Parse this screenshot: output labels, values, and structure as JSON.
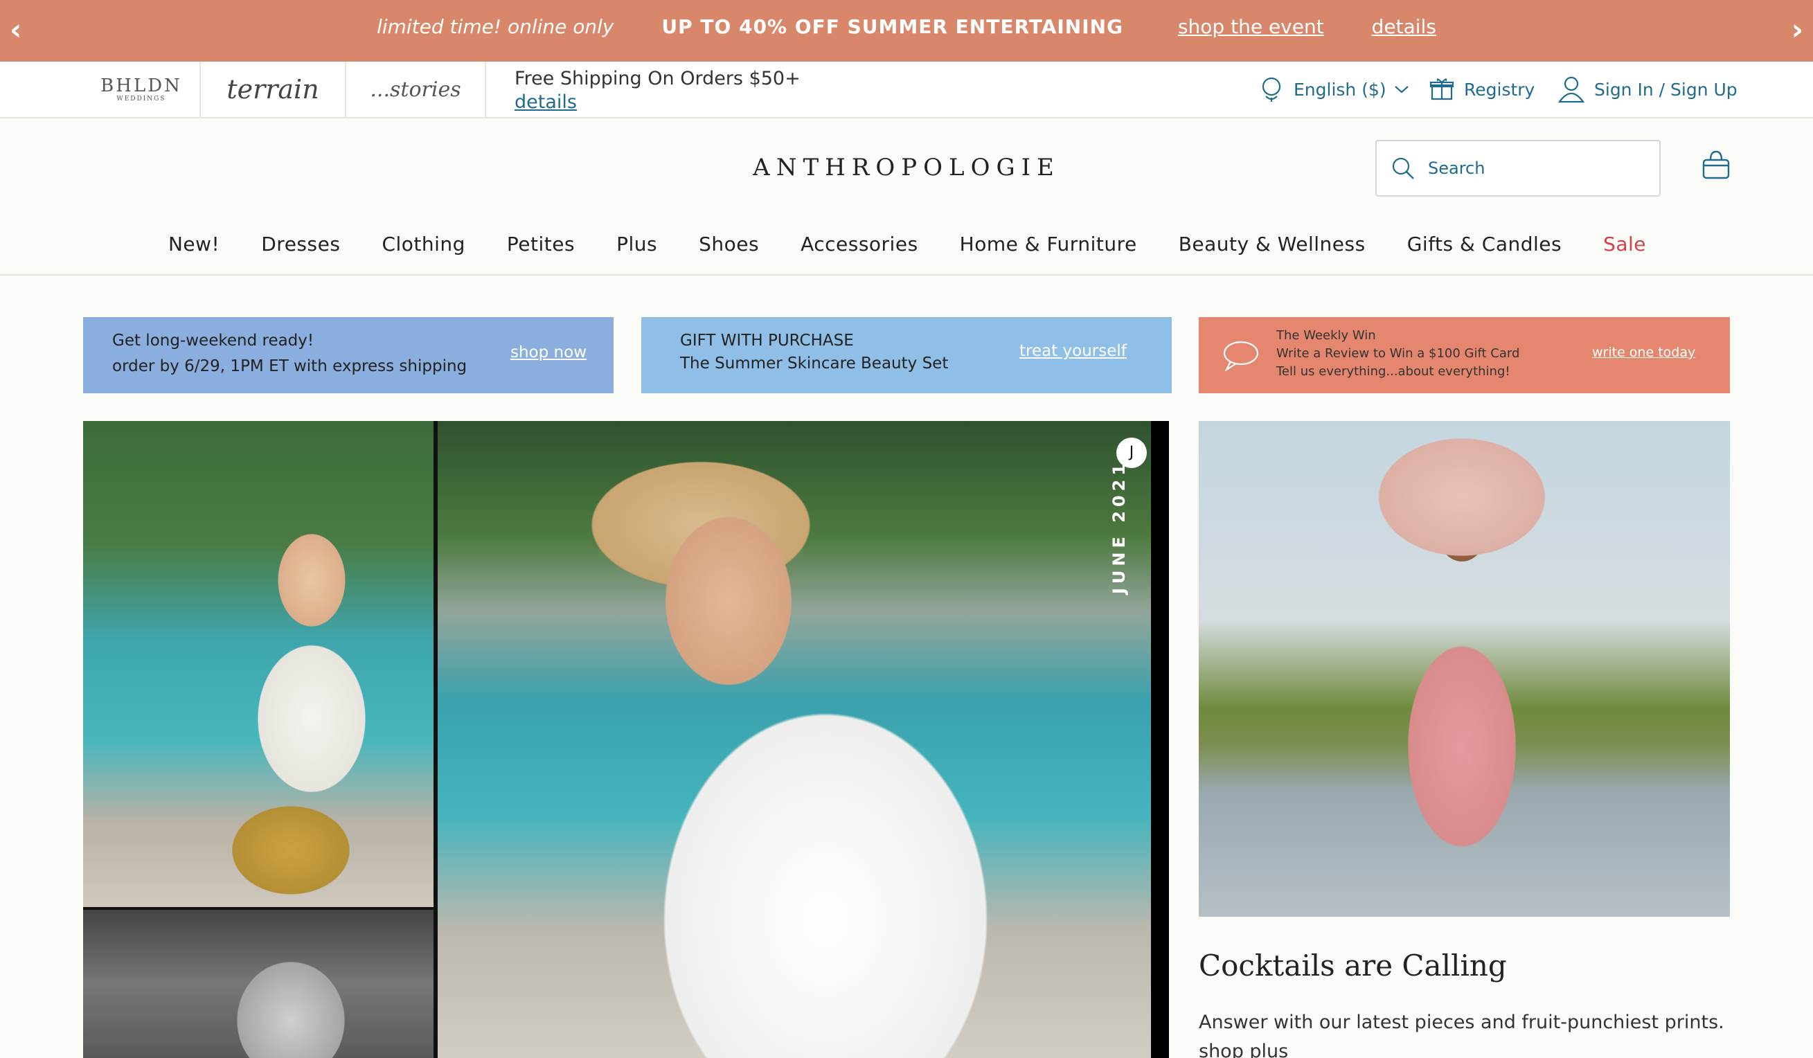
{
  "promo": {
    "prev_icon": "chevron-left",
    "next_icon": "chevron-right",
    "tagline": "limited time! online only",
    "headline": "UP TO 40% OFF SUMMER ENTERTAINING",
    "link_event": "shop the event",
    "link_details": "details",
    "bg_color": "#d8876b"
  },
  "utility": {
    "brands": {
      "bhldn": "BHLDN",
      "bhldn_sub": "WEDDINGS",
      "terrain": "terrain",
      "stories": "...stories"
    },
    "shipping": {
      "text": "Free Shipping On Orders $50+",
      "link": "details"
    },
    "language": "English ($)",
    "registry": "Registry",
    "signin": "Sign In / Sign Up"
  },
  "header": {
    "logo": "ANTHROPOLOGIE",
    "search_placeholder": "Search"
  },
  "nav": {
    "items": [
      "New!",
      "Dresses",
      "Clothing",
      "Petites",
      "Plus",
      "Shoes",
      "Accessories",
      "Home & Furniture",
      "Beauty & Wellness",
      "Gifts & Candles",
      "Sale"
    ]
  },
  "banners": {
    "b1": {
      "line1": "Get long-weekend ready!",
      "line2": "order by 6/29, 1PM ET with express shipping",
      "cta": "shop now"
    },
    "b2": {
      "line1": "GIFT WITH PURCHASE",
      "line2": "The Summer Skincare Beauty Set",
      "cta": "treat yourself"
    },
    "b3": {
      "line1": "The Weekly Win",
      "line2": "Write a Review to Win a $100 Gift Card",
      "line3": "Tell us everything...about everything!",
      "cta": "write one today"
    }
  },
  "hero": {
    "badge": "J",
    "date_label": "JUNE 2021"
  },
  "story": {
    "title": "Cocktails are Calling",
    "text": "Answer with our latest pieces and fruit-punchiest prints.",
    "link": "shop plus"
  }
}
